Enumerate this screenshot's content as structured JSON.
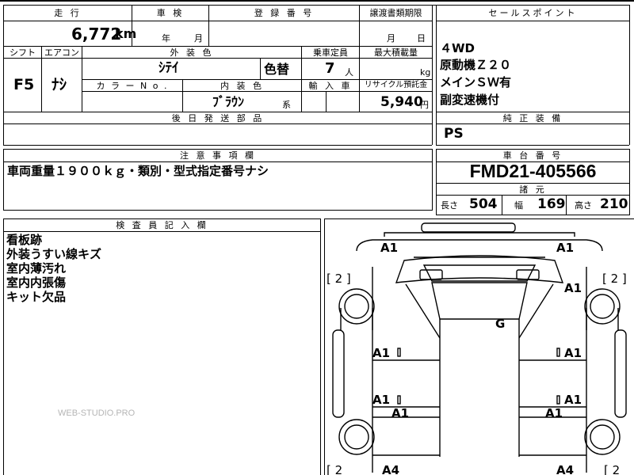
{
  "top_row_fragments": {
    "left": "",
    "mid": "",
    "right": ""
  },
  "row1": {
    "mileage_header": "走 行",
    "mileage_value": "6,772",
    "mileage_unit": "km",
    "shaken_header": "車 検",
    "shaken_year": "年",
    "shaken_month": "月",
    "reg_header": "登 録 番 号",
    "transfer_header": "譲渡書類期限",
    "transfer_month": "月",
    "transfer_day": "日",
    "sales_header": "セールスポイント"
  },
  "row2": {
    "shift_header": "シフト",
    "aircon_header": "エアコン",
    "ext_color_header": "外 装 色",
    "capacity_header": "乗車定員",
    "max_load_header": "最大積載量",
    "shift_value": "F5",
    "aircon_value": "ﾅｼ",
    "ext_color_value": "ｼﾃｲ",
    "color_change": "色替",
    "capacity_value": "7",
    "capacity_unit": "人",
    "load_unit": "kg",
    "color_no_header": "カ ラ ー  N o .",
    "int_color_header": "内 装 色",
    "import_header": "輸 入 車",
    "recycle_header": "リサイクル預託金",
    "int_color_value": "ﾌﾞﾗｳﾝ",
    "int_color_suffix": "系",
    "recycle_value": "5,940",
    "recycle_unit": "円"
  },
  "sales_points": [
    "４WD",
    "原動機Ｚ２０",
    "メインＳＷ有",
    "副変速機付"
  ],
  "later_parts_header": "後 日 発 送 部 品",
  "genuine_header": "純 正 装 備",
  "genuine_value": "PS",
  "notes_header": "注 意 事 項 欄",
  "notes_value": "車両重量１９００ｋｇ・類別・型式指定番号ナシ",
  "chassis_header": "車 台 番 号",
  "chassis_value": "FMD21-405566",
  "dims_header": "諸 元",
  "dims": {
    "length_label": "長さ",
    "length_value": "504",
    "width_label": "幅",
    "width_value": "169",
    "height_label": "高さ",
    "height_value": "210"
  },
  "inspector_header": "検 査 員 記 入 欄",
  "inspector_notes": [
    "看板跡",
    "外装うすい線キズ",
    "室内薄汚れ",
    "室内内張傷",
    "キット欠品"
  ],
  "watermark": "WEB-STUDIO.PRO",
  "diagram_marks": {
    "a1_top_left": "A1",
    "a1_top_right": "A1",
    "a1_right_upper": "A1",
    "g_center": "G",
    "a1_left_mid": "A1",
    "a1_right_mid": "A1",
    "a1_left_low": "A1",
    "a1_right_low": "A1",
    "a1_left_bottom": "A1",
    "a1_right_bottom": "A1",
    "a4_left": "A4",
    "a4_right": "A4",
    "bracket_left_top": "[ 2 ]",
    "bracket_right_top": "[ 2 ]",
    "bracket_left_bottom": "[ 2",
    "bracket_right_bottom": "[ 2"
  }
}
